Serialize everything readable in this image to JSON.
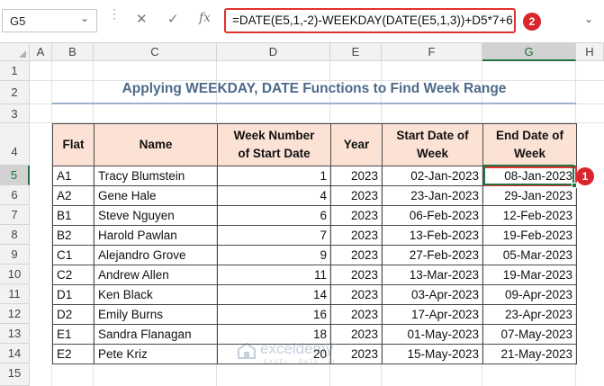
{
  "formula_bar": {
    "name_box": "G5",
    "cancel_icon": "✕",
    "enter_icon": "✓",
    "fx_label": "fx",
    "formula": "=DATE(E5,1,-2)-WEEKDAY(DATE(E5,1,3))+D5*7+6",
    "badge_1": "1",
    "badge_2": "2"
  },
  "grid": {
    "columns": [
      "A",
      "B",
      "C",
      "D",
      "E",
      "F",
      "G",
      "H"
    ],
    "rows": [
      "1",
      "2",
      "3",
      "4",
      "5",
      "6",
      "7",
      "8",
      "9",
      "10",
      "11",
      "12",
      "13",
      "14",
      "15"
    ],
    "selected_column": "G",
    "selected_row": "5"
  },
  "title": "Applying WEEKDAY, DATE Functions to Find Week Range",
  "table": {
    "headers": {
      "flat": "Flat",
      "name": "Name",
      "week_line1": "Week Number",
      "week_line2": "of Start Date",
      "year": "Year",
      "start_line1": "Start Date of",
      "start_line2": "Week",
      "end_line1": "End Date of",
      "end_line2": "Week"
    },
    "rows": [
      {
        "flat": "A1",
        "name": "Tracy Blumstein",
        "week": "1",
        "year": "2023",
        "start": "02-Jan-2023",
        "end": "08-Jan-2023"
      },
      {
        "flat": "A2",
        "name": "Gene Hale",
        "week": "4",
        "year": "2023",
        "start": "23-Jan-2023",
        "end": "29-Jan-2023"
      },
      {
        "flat": "B1",
        "name": "Steve Nguyen",
        "week": "6",
        "year": "2023",
        "start": "06-Feb-2023",
        "end": "12-Feb-2023"
      },
      {
        "flat": "B2",
        "name": "Harold Pawlan",
        "week": "7",
        "year": "2023",
        "start": "13-Feb-2023",
        "end": "19-Feb-2023"
      },
      {
        "flat": "C1",
        "name": "Alejandro Grove",
        "week": "9",
        "year": "2023",
        "start": "27-Feb-2023",
        "end": "05-Mar-2023"
      },
      {
        "flat": "C2",
        "name": "Andrew Allen",
        "week": "11",
        "year": "2023",
        "start": "13-Mar-2023",
        "end": "19-Mar-2023"
      },
      {
        "flat": "D1",
        "name": "Ken Black",
        "week": "14",
        "year": "2023",
        "start": "03-Apr-2023",
        "end": "09-Apr-2023"
      },
      {
        "flat": "D2",
        "name": "Emily Burns",
        "week": "16",
        "year": "2023",
        "start": "17-Apr-2023",
        "end": "23-Apr-2023"
      },
      {
        "flat": "E1",
        "name": "Sandra Flanagan",
        "week": "18",
        "year": "2023",
        "start": "01-May-2023",
        "end": "07-May-2023"
      },
      {
        "flat": "E2",
        "name": "Pete Kriz",
        "week": "20",
        "year": "2023",
        "start": "15-May-2023",
        "end": "21-May-2023"
      }
    ]
  },
  "watermark": {
    "name": "exceldemy",
    "tagline": "EXCEL · DATA · BI"
  },
  "colors": {
    "header_fill": "#fbe2d5",
    "title_color": "#4d6a8a",
    "highlight_red": "#e0322c",
    "excel_green": "#217346"
  }
}
